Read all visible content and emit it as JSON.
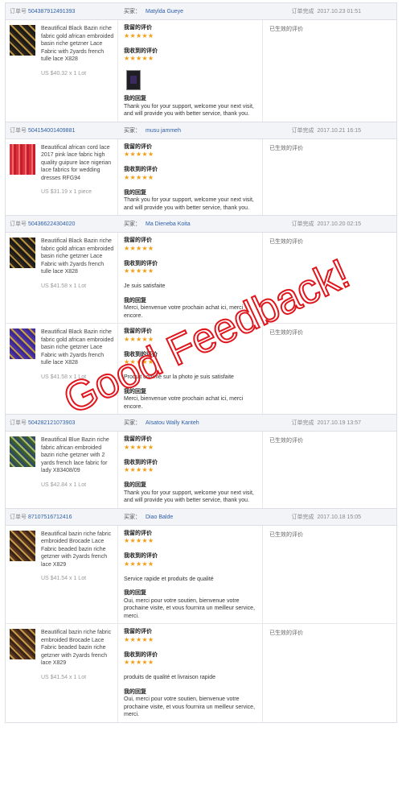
{
  "labels": {
    "order_no": "订单号",
    "buyer": "买家：",
    "completed": "订单完成",
    "my_feedback": "我留的评价",
    "received_feedback": "我收到的评价",
    "my_reply": "我的回复",
    "status": "已生效的评价"
  },
  "overlay_text": "Good Feedback!",
  "colors": {
    "star": "#f39c12",
    "link": "#2f5fa8",
    "overlay": "#e0161d",
    "header_bg": "#f2f4f7"
  },
  "orders": [
    {
      "order_no": "504387912491393",
      "buyer": "Matylda Gueye",
      "time": "2017.10.23 01:51",
      "items": [
        {
          "title": "Beautifical Black Bazin riche fabric gold african embroided basin riche getzner Lace Fabric with 2yards french tulle lace X828",
          "price": "US $40.32 x 1 Lot",
          "thumb": "black-gold",
          "my_stars": "★★★★★",
          "recv_stars": "★★★★★",
          "comment": "",
          "photo": true,
          "reply": "Thank you for your support, welcome your next visit, and will provide you with better service, thank you."
        }
      ]
    },
    {
      "order_no": "504154001409881",
      "buyer": "musu jammeh",
      "time": "2017.10.21 16:15",
      "items": [
        {
          "title": "Beautifical african cord lace 2017 pink lace fabric high quality guipure lace nigerian lace fabrics for wedding dresses RFG94",
          "price": "US $31.19 x 1 piece",
          "thumb": "red-cord",
          "my_stars": "★★★★★",
          "recv_stars": "★★★★★",
          "comment": "",
          "photo": false,
          "reply": "Thank you for your support, welcome your next visit, and will provide you with better service, thank you."
        }
      ]
    },
    {
      "order_no": "504366224304020",
      "buyer": "Ma Dieneba Koita",
      "time": "2017.10.20 02:15",
      "items": [
        {
          "title": "Beautifical Black Bazin riche fabric gold african embroided basin riche getzner Lace Fabric with 2yards french tulle lace X828",
          "price": "US $41.58 x 1 Lot",
          "thumb": "black-gold",
          "my_stars": "★★★★★",
          "recv_stars": "★★★★★",
          "comment": "Je suis satisfaite",
          "photo": false,
          "reply": "Merci, bienvenue votre prochain achat ici, merci encore."
        },
        {
          "title": "Beautifical Black Bazin riche fabric gold african embroided basin riche getzner Lace Fabric with 2yards french tulle lace X828",
          "price": "US $41.58 x 1 Lot",
          "thumb": "purple-gold",
          "my_stars": "★★★★★",
          "recv_stars": "★★★★★",
          "comment": "Produit comme sur la photo je suis satisfaite",
          "photo": false,
          "reply": "Merci, bienvenue votre prochain achat ici, merci encore."
        }
      ]
    },
    {
      "order_no": "504282121073903",
      "buyer": "Aïsatou Wally Kanteh",
      "time": "2017.10.19 13:57",
      "items": [
        {
          "title": "Beautifical Blue Bazin riche fabric african embroided bazin riche getzner with 2 yards french lace fabric for lady X83408/09",
          "price": "US $42.84 x 1 Lot",
          "thumb": "green-blue",
          "my_stars": "★★★★★",
          "recv_stars": "★★★★★",
          "comment": "",
          "photo": false,
          "reply": "Thank you for your support, welcome your next visit, and will provide you with better service, thank you."
        }
      ]
    },
    {
      "order_no": "87107516712416",
      "buyer": "Diao Balde",
      "time": "2017.10.18 15:05",
      "items": [
        {
          "title": "Beautifical bazin riche fabric embroided Brocade Lace Fabric beaded bazin riche getzner with 2yards french lace X829",
          "price": "US $41.54 x 1 Lot",
          "thumb": "dark-gold",
          "my_stars": "★★★★★",
          "recv_stars": "★★★★★",
          "comment": "Service rapide et produits de qualité",
          "photo": false,
          "reply": "Oui, merci pour votre soutien, bienvenue votre prochaine visite, et vous fournira un meilleur service, merci."
        },
        {
          "title": "Beautifical bazin riche fabric embroided Brocade Lace Fabric beaded bazin riche getzner with 2yards french lace X829",
          "price": "US $41.54 x 1 Lot",
          "thumb": "dark-gold",
          "my_stars": "★★★★★",
          "recv_stars": "★★★★★",
          "comment": "produits de qualité et livraison rapide",
          "photo": false,
          "reply": "Oui, merci pour votre soutien, bienvenue votre prochaine visite, et vous fournira un meilleur service, merci."
        }
      ]
    }
  ]
}
